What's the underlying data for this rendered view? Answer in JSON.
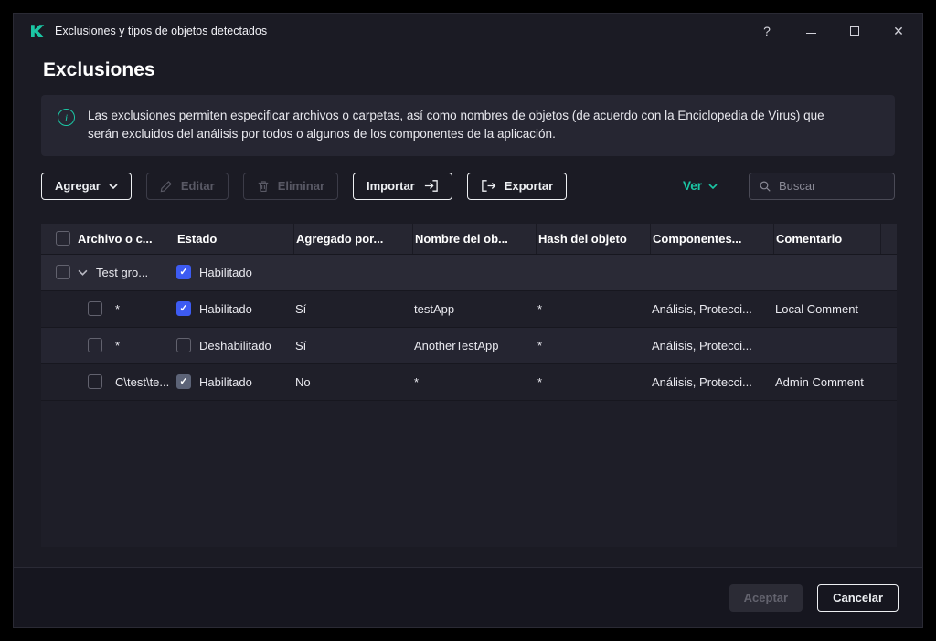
{
  "window": {
    "title": "Exclusiones y tipos de objetos detectados",
    "controls": {
      "help": "?"
    }
  },
  "page": {
    "title": "Exclusiones",
    "info": "Las exclusiones permiten especificar archivos o carpetas, así como nombres de objetos (de acuerdo con la Enciclopedia de Virus) que serán excluidos del análisis por todos o algunos de los componentes de la aplicación."
  },
  "toolbar": {
    "agregar": "Agregar",
    "editar": "Editar",
    "eliminar": "Eliminar",
    "importar": "Importar",
    "exportar": "Exportar",
    "ver": "Ver",
    "search_placeholder": "Buscar"
  },
  "table": {
    "columns": [
      "Archivo o c...",
      "Estado",
      "Agregado por...",
      "Nombre del ob...",
      "Hash del objeto",
      "Componentes...",
      "Comentario"
    ],
    "rows": [
      {
        "name": "Test gro...",
        "estado_label": "Habilitado",
        "estado_checked": true
      },
      {
        "archivo": "*",
        "estado_label": "Habilitado",
        "estado_checked": true,
        "agregado": "Sí",
        "nombre": "testApp",
        "hash": "*",
        "componentes": "Análisis, Protecci...",
        "comentario": "Local Comment"
      },
      {
        "archivo": "*",
        "estado_label": "Deshabilitado",
        "estado_checked": false,
        "agregado": "Sí",
        "nombre": "AnotherTestApp",
        "hash": "*",
        "componentes": "Análisis, Protecci...",
        "comentario": ""
      },
      {
        "archivo": "C\\test\\te...",
        "estado_label": "Habilitado",
        "estado_checked": true,
        "estado_disabled": true,
        "agregado": "No",
        "nombre": "*",
        "hash": "*",
        "componentes": "Análisis, Protecci...",
        "comentario": "Admin Comment"
      }
    ]
  },
  "footer": {
    "aceptar": "Aceptar",
    "cancelar": "Cancelar"
  },
  "colors": {
    "accent_green": "#1bc6a4",
    "checkbox_blue": "#3d5bf2"
  }
}
